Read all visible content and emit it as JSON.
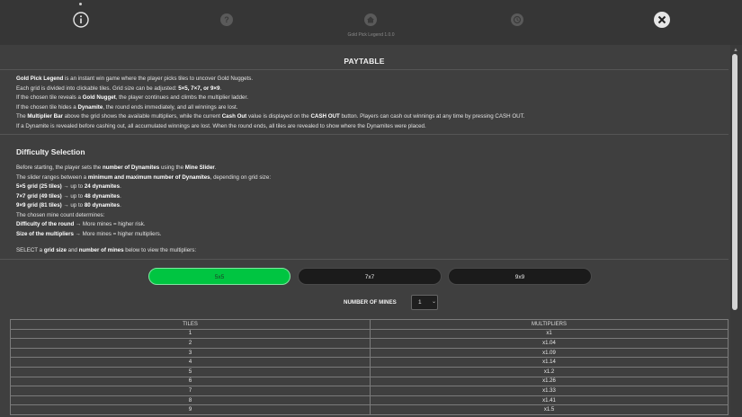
{
  "header": {
    "version": "Gold Pick Legend 1.0.0",
    "icons": [
      "info-icon",
      "help-icon",
      "home-icon",
      "history-icon",
      "close-icon"
    ]
  },
  "paytable": {
    "title": "PAYTABLE",
    "intro": {
      "l1_b1": "Gold Pick Legend",
      "l1_t1": " is an instant win game where the player picks tiles to uncover Gold Nuggets.",
      "l2_t1": "Each grid is divided into clickable tiles. Grid size can be adjusted: ",
      "l2_b1": "5×5, 7×7, or 9×9",
      "l2_t2": ".",
      "l3_t1": "If the chosen tile reveals a ",
      "l3_b1": "Gold Nugget",
      "l3_t2": ", the player continues and climbs the multiplier ladder.",
      "l4_t1": "If the chosen tile hides a ",
      "l4_b1": "Dynamite",
      "l4_t2": ", the round ends immediately, and all winnings are lost.",
      "l5_t1": "The ",
      "l5_b1": "Multiplier Bar",
      "l5_t2": " above the grid shows the available multipliers, while the current ",
      "l5_b2": "Cash Out",
      "l5_t3": " value is displayed on the ",
      "l5_b3": "CASH OUT",
      "l5_t4": " button. Players can cash out winnings at any time by pressing CASH OUT.",
      "l6_t1": "If a Dynamite is revealed before cashing out, all accumulated winnings are lost. When the round ends, all tiles are revealed to show where the Dynamites were placed."
    },
    "difficulty": {
      "title": "Difficulty Selection",
      "d1_t1": "Before starting, the player sets the ",
      "d1_b1": "number of Dynamites",
      "d1_t2": " using the ",
      "d1_b2": "Mine Slider",
      "d1_t3": ".",
      "d2_t1": "The slider ranges between a ",
      "d2_b1": "minimum and maximum number of Dynamites",
      "d2_t2": ", depending on grid size:",
      "d3_b1": "5×5 grid (25 tiles)",
      "d3_t1": " → up to ",
      "d3_b2": "24 dynamites",
      "d3_t2": ".",
      "d4_b1": "7×7 grid (49 tiles)",
      "d4_t1": " → up to ",
      "d4_b2": "48 dynamites",
      "d4_t2": ".",
      "d5_b1": "9×9 grid (81 tiles)",
      "d5_t1": " → up to ",
      "d5_b2": "80 dynamites",
      "d5_t2": ".",
      "d6_t1": "The chosen mine count determines:",
      "d7_b1": "Difficulty of the round",
      "d7_t1": " → More mines = higher risk.",
      "d8_b1": "Size of the multipliers",
      "d8_t1": " → More mines = higher multipliers.",
      "s_t1": "SELECT a ",
      "s_b1": "grid size",
      "s_t2": " and ",
      "s_b2": "number of mines",
      "s_t3": " below to view the multipliers:"
    },
    "grid_buttons": [
      "5x5",
      "7x7",
      "9x9"
    ],
    "selected_grid": "5x5",
    "mines_label": "NUMBER OF MINES",
    "mines_value": "1",
    "table": {
      "headers": [
        "TILES",
        "MULTIPLIERS"
      ],
      "rows": [
        [
          "1",
          "x1"
        ],
        [
          "2",
          "x1.04"
        ],
        [
          "3",
          "x1.09"
        ],
        [
          "4",
          "x1.14"
        ],
        [
          "5",
          "x1.2"
        ],
        [
          "6",
          "x1.26"
        ],
        [
          "7",
          "x1.33"
        ],
        [
          "8",
          "x1.41"
        ],
        [
          "9",
          "x1.5"
        ]
      ]
    }
  },
  "colors": {
    "accent_green": "#00c541",
    "background": "#3f3f3f",
    "topbar": "#363636"
  }
}
